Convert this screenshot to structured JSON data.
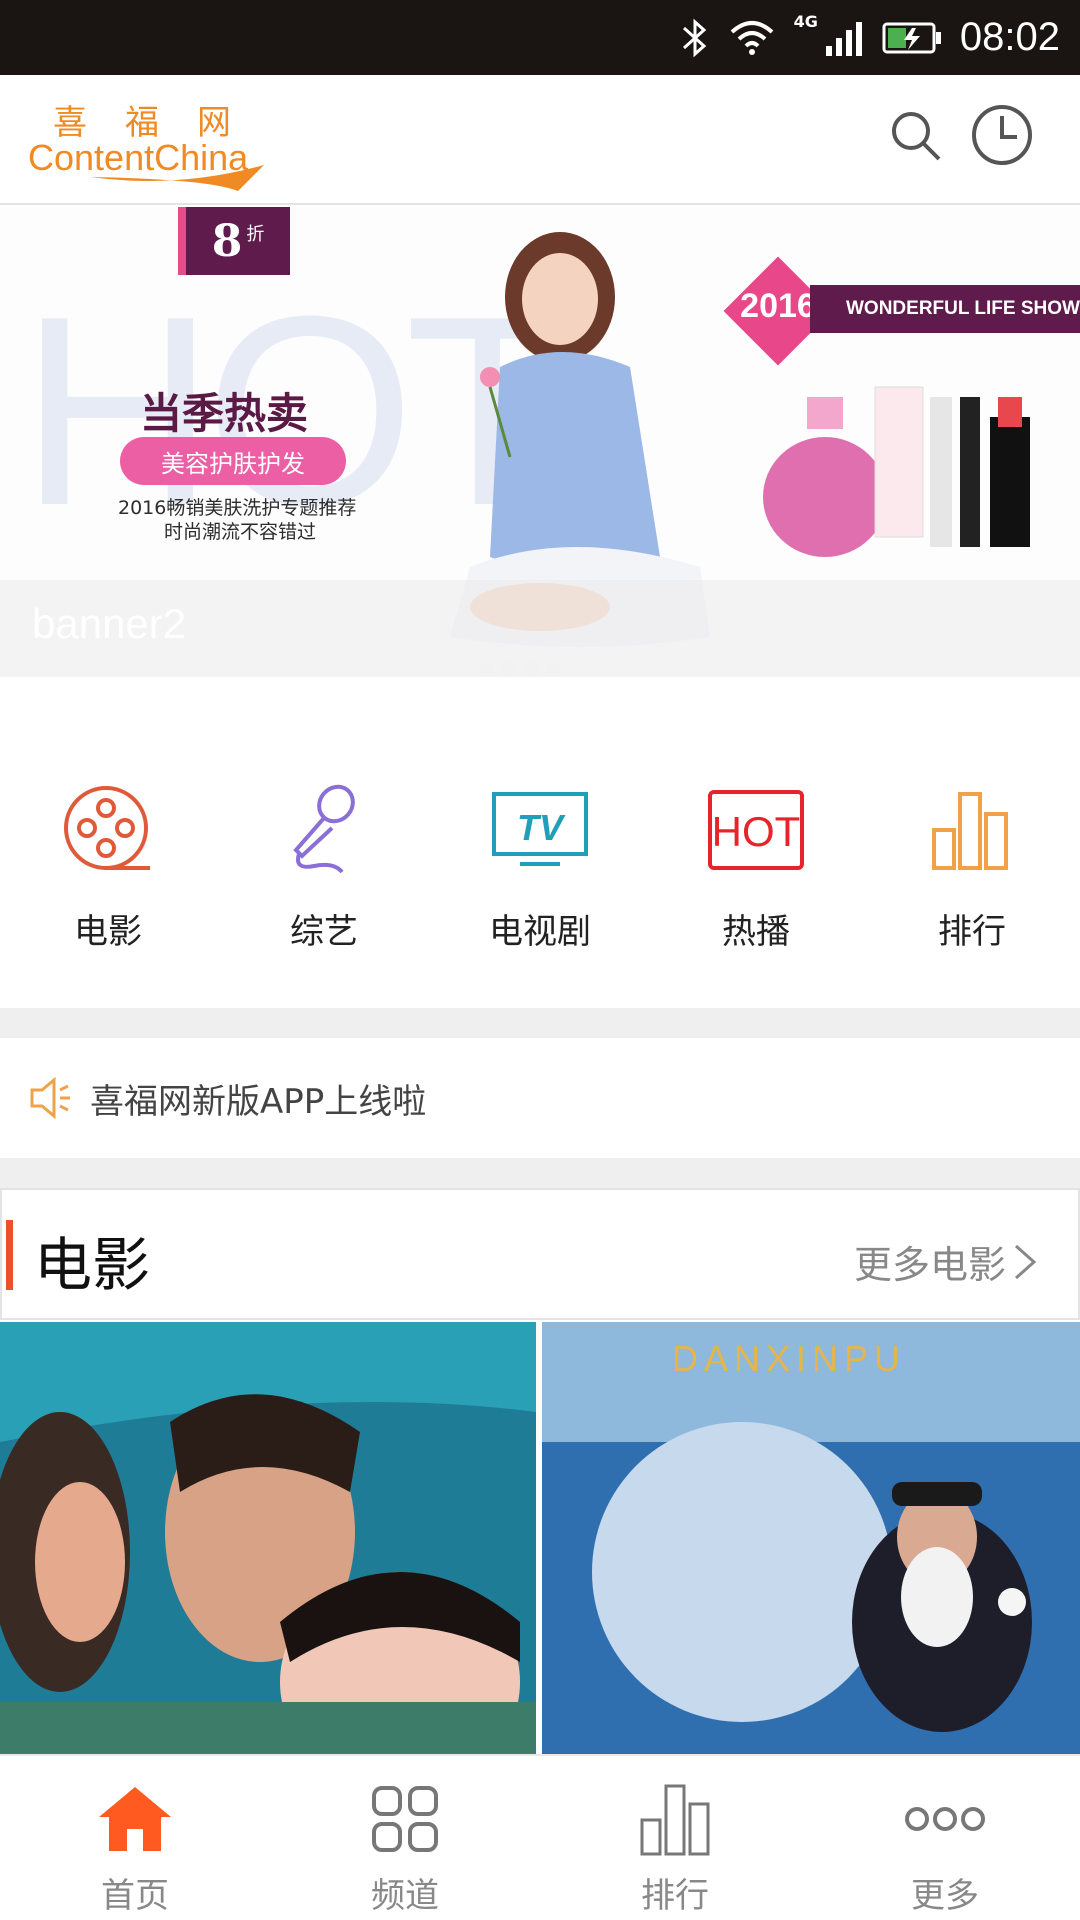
{
  "status_bar": {
    "time": "08:02",
    "network": "4G"
  },
  "header": {
    "logo_cn": "喜福网",
    "logo_en": "ContentChina"
  },
  "banner": {
    "badge_num": "8",
    "badge_unit": "折",
    "bg_word": "HOT",
    "title": "当季热卖",
    "pill": "美容护肤护发",
    "sub1": "2016畅销美肤洗护专题推荐",
    "sub2": "时尚潮流不容错过",
    "year": "2016",
    "show": "WONDERFUL LIFE SHOW",
    "caption": "banner2"
  },
  "categories": [
    {
      "label": "电影",
      "icon": "film-reel-icon"
    },
    {
      "label": "综艺",
      "icon": "microphone-icon"
    },
    {
      "label": "电视剧",
      "icon": "tv-icon"
    },
    {
      "label": "热播",
      "icon": "hot-icon"
    },
    {
      "label": "排行",
      "icon": "ranking-bars-icon"
    }
  ],
  "notice": {
    "text": "喜福网新版APP上线啦"
  },
  "section": {
    "title": "电影",
    "more": "更多电影"
  },
  "posters": [
    {
      "title": ""
    },
    {
      "title": "DANXINPU"
    }
  ],
  "tabs": [
    {
      "label": "首页",
      "icon": "home-icon"
    },
    {
      "label": "频道",
      "icon": "grid-icon"
    },
    {
      "label": "排行",
      "icon": "bar-chart-icon"
    },
    {
      "label": "更多",
      "icon": "more-dots-icon"
    }
  ],
  "colors": {
    "accent": "#ff5a1f",
    "logo": "#f08a24",
    "section_bar": "#e9522b",
    "banner_purple": "#5e1b4c",
    "banner_pink": "#ec5fa4"
  }
}
